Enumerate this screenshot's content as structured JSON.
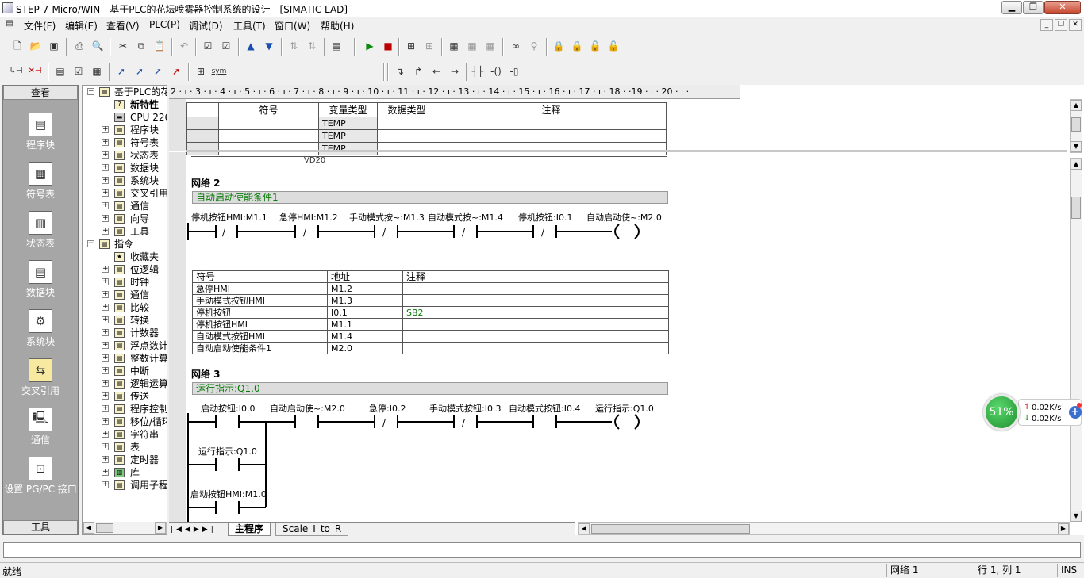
{
  "window": {
    "title": "STEP 7-Micro/WIN - 基于PLC的花坛喷雾器控制系统的设计 - [SIMATIC LAD]",
    "minimize": "▁",
    "maximize": "❐",
    "close": "✕"
  },
  "menu": [
    "文件(F)",
    "编辑(E)",
    "查看(V)",
    "PLC(P)",
    "调试(D)",
    "工具(T)",
    "窗口(W)",
    "帮助(H)"
  ],
  "nav": {
    "header": "查看",
    "footer": "工具",
    "items": [
      {
        "label": "程序块",
        "icon": "program-block-icon"
      },
      {
        "label": "符号表",
        "icon": "symbol-table-icon"
      },
      {
        "label": "状态表",
        "icon": "status-table-icon"
      },
      {
        "label": "数据块",
        "icon": "data-block-icon"
      },
      {
        "label": "系统块",
        "icon": "system-block-icon"
      },
      {
        "label": "交叉引用",
        "icon": "cross-reference-icon"
      },
      {
        "label": "通信",
        "icon": "communication-icon"
      },
      {
        "label": "设置 PG/PC 接口",
        "icon": "pgpc-interface-icon"
      }
    ]
  },
  "tree": {
    "root": "基于PLC的花",
    "items": [
      {
        "label": "新特性",
        "bold": true
      },
      {
        "label": "CPU 226"
      },
      {
        "label": "程序块"
      },
      {
        "label": "符号表"
      },
      {
        "label": "状态表"
      },
      {
        "label": "数据块"
      },
      {
        "label": "系统块"
      },
      {
        "label": "交叉引用"
      },
      {
        "label": "通信"
      },
      {
        "label": "向导"
      },
      {
        "label": "工具"
      }
    ],
    "instr_root": "指令",
    "instr_items": [
      "收藏夹",
      "位逻辑",
      "时钟",
      "通信",
      "比较",
      "转换",
      "计数器",
      "浮点数计",
      "整数计算",
      "中断",
      "逻辑运算",
      "传送",
      "程序控制",
      "移位/循环",
      "字符串",
      "表",
      "定时器",
      "库",
      "调用子程"
    ]
  },
  "ruler": "2 · ı · 3 · ı · 4 · ı · 5 · ı · 6 · ı · 7 · ı · 8 · ı · 9 · ı · 10 · ı · 11 · ı · 12 · ı · 13 · ı · 14 · ı · 15 · ı · 16 · ı · 17 · ı · 18 ·    ·19 · ı · 20 · ı ·",
  "var_table": {
    "headers": [
      "符号",
      "变量类型",
      "数据类型",
      "注释"
    ],
    "rows": [
      "TEMP",
      "TEMP",
      "TEMP"
    ],
    "partial_row": "VD20"
  },
  "networks": [
    {
      "label": "网络 2",
      "comment": "自动启动使能条件1",
      "contacts": [
        "停机按钮HMI:M1.1",
        "急停HMI:M1.2",
        "手动模式按~:M1.3",
        "自动模式按~:M1.4",
        "停机按钮:I0.1"
      ],
      "coil": "自动启动使~:M2.0",
      "symbols": {
        "headers": [
          "符号",
          "地址",
          "注释"
        ],
        "rows": [
          [
            "急停HMI",
            "M1.2",
            ""
          ],
          [
            "手动模式按钮HMI",
            "M1.3",
            ""
          ],
          [
            "停机按钮",
            "I0.1",
            "SB2"
          ],
          [
            "停机按钮HMI",
            "M1.1",
            ""
          ],
          [
            "自动模式按钮HMI",
            "M1.4",
            ""
          ],
          [
            "自动启动使能条件1",
            "M2.0",
            ""
          ]
        ]
      }
    },
    {
      "label": "网络 3",
      "comment": "运行指示:Q1.0",
      "contacts": [
        "启动按钮:I0.0",
        "自动启动使~:M2.0",
        "急停:I0.2",
        "手动模式按钮:I0.3",
        "自动模式按钮:I0.4"
      ],
      "coil": "运行指示:Q1.0",
      "branches": [
        "运行指示:Q1.0",
        "启动按钮HMI:M1.0"
      ]
    }
  ],
  "tabs": [
    "主程序",
    "Scale_I_to_R"
  ],
  "status": {
    "left": "就绪",
    "network": "网络 1",
    "position": "行 1, 列 1",
    "mode": "INS"
  },
  "net_widget": {
    "percent": "51%",
    "up": "0.02K/s",
    "down": "0.02K/s"
  }
}
